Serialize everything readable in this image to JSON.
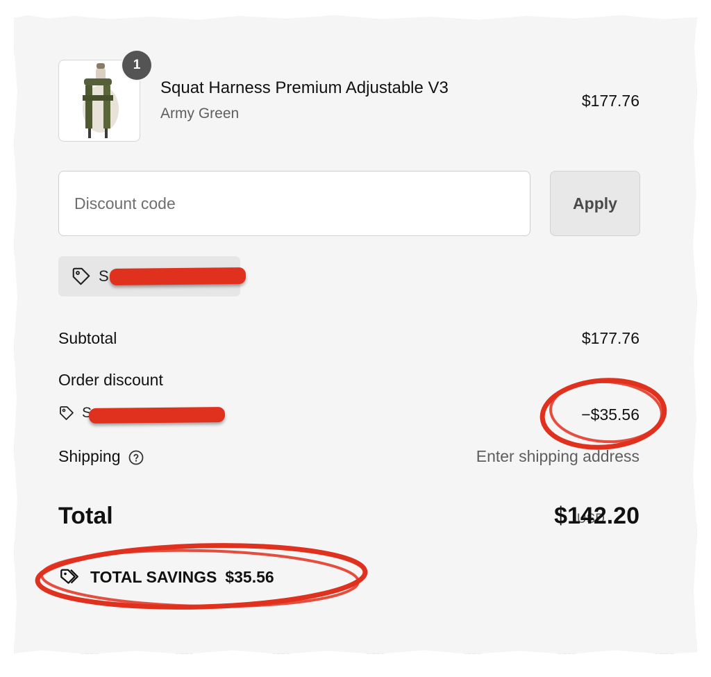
{
  "cart": {
    "item": {
      "name": "Squat Harness Premium Adjustable V3",
      "variant": "Army Green",
      "price": "$177.76",
      "quantity_badge": "1",
      "image_icon": "harness-product-image"
    }
  },
  "discount": {
    "placeholder": "Discount code",
    "apply_label": "Apply",
    "applied_code_visible": "S"
  },
  "summary": {
    "subtotal_label": "Subtotal",
    "subtotal_value": "$177.76",
    "order_discount_label": "Order discount",
    "order_discount_code_visible": "S",
    "order_discount_value": "−$35.56",
    "shipping_label": "Shipping",
    "shipping_value": "Enter shipping address",
    "total_label": "Total",
    "currency": "USD",
    "total_value": "$142.20",
    "savings_label": "TOTAL SAVINGS",
    "savings_value": "$35.56"
  },
  "colors": {
    "page_background": "#f5f5f5",
    "annotation_red": "#e0301e",
    "badge": "#545454"
  },
  "icons": [
    "tag-icon",
    "help-circle-icon",
    "tags-icon"
  ]
}
